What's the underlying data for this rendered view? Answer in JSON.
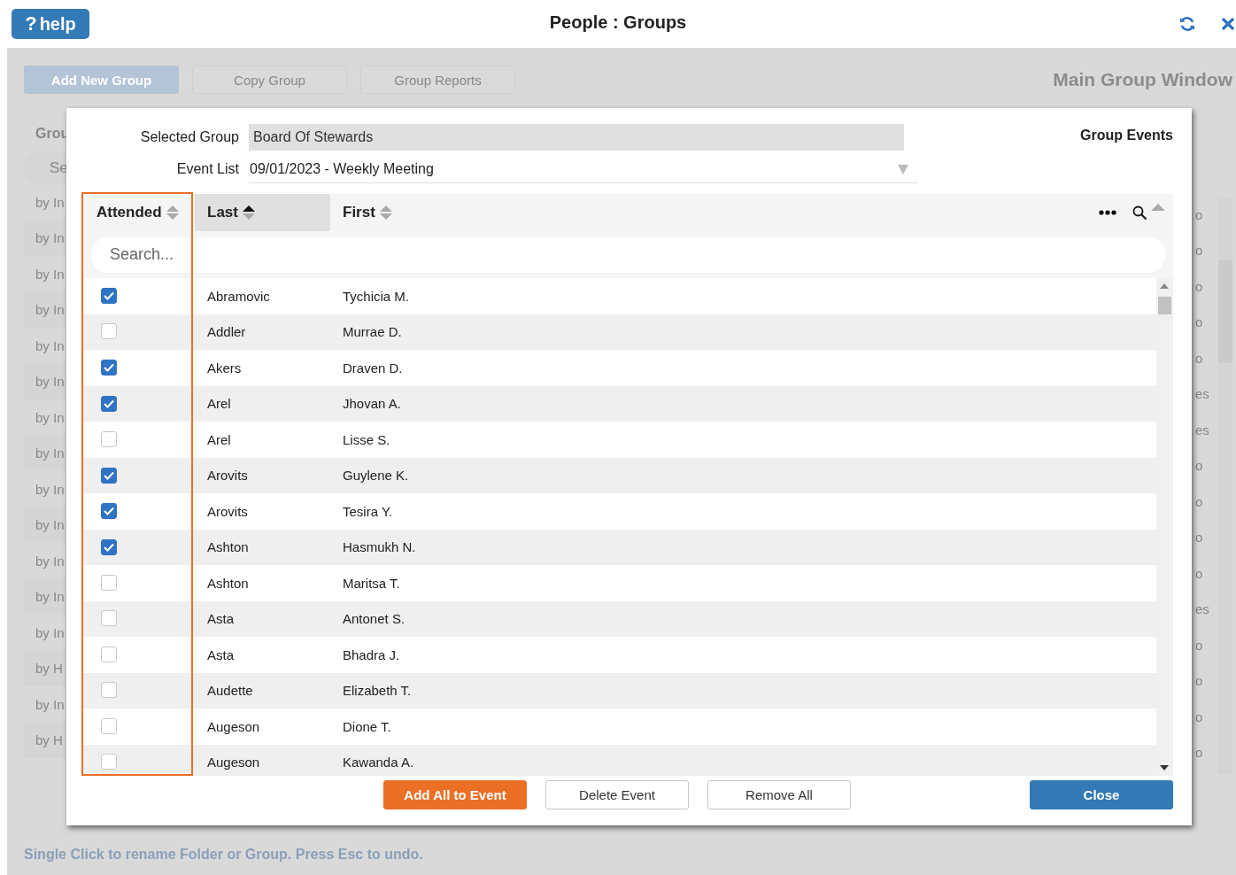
{
  "header": {
    "help_button": {
      "icon": "?",
      "label": "help"
    },
    "title": "People : Groups"
  },
  "background": {
    "toolbar": [
      {
        "label": "Add New Group",
        "kind": "primary"
      },
      {
        "label": "Copy Group",
        "kind": "plain"
      },
      {
        "label": "Group Reports",
        "kind": "plain"
      }
    ],
    "window_title": "Main Group Window",
    "panel_label": "Grou",
    "search_placeholder": "Se",
    "left_rows": [
      "by In",
      "by In",
      "by In",
      "by In",
      "by In",
      "by In",
      "by In",
      "by In",
      "by In",
      "by In",
      "by In",
      "by In",
      "by In",
      "by H",
      "by In",
      "by H"
    ],
    "right_rows": [
      "o",
      "o",
      "o",
      "o",
      "o",
      "es",
      "es",
      "o",
      "o",
      "o",
      "o",
      "es",
      "o",
      "o",
      "o",
      "o"
    ],
    "status_bar": "Single Click to rename Folder or Group. Press Esc to undo."
  },
  "dialog": {
    "title": "Group Events",
    "selected_group": {
      "label": "Selected Group",
      "value": "Board Of Stewards"
    },
    "event_list": {
      "label": "Event List",
      "value": "09/01/2023 - Weekly Meeting"
    },
    "table": {
      "columns": [
        {
          "label": "Attended",
          "sorted": false,
          "selected": false
        },
        {
          "label": "Last",
          "sorted": true,
          "selected": true
        },
        {
          "label": "First",
          "sorted": false,
          "selected": false
        }
      ],
      "search_placeholder": "Search...",
      "rows": [
        {
          "attended": true,
          "last": "Abramovic",
          "first": "Tychicia M."
        },
        {
          "attended": false,
          "last": "Addler",
          "first": "Murrae D."
        },
        {
          "attended": true,
          "last": "Akers",
          "first": "Draven D."
        },
        {
          "attended": true,
          "last": "Arel",
          "first": "Jhovan A."
        },
        {
          "attended": false,
          "last": "Arel",
          "first": "Lisse S."
        },
        {
          "attended": true,
          "last": "Arovits",
          "first": "Guylene K."
        },
        {
          "attended": true,
          "last": "Arovits",
          "first": "Tesira Y."
        },
        {
          "attended": true,
          "last": "Ashton",
          "first": "Hasmukh N."
        },
        {
          "attended": false,
          "last": "Ashton",
          "first": "Maritsa T."
        },
        {
          "attended": false,
          "last": "Asta",
          "first": "Antonet S."
        },
        {
          "attended": false,
          "last": "Asta",
          "first": "Bhadra J."
        },
        {
          "attended": false,
          "last": "Audette",
          "first": "Elizabeth T."
        },
        {
          "attended": false,
          "last": "Augeson",
          "first": "Dione T."
        },
        {
          "attended": false,
          "last": "Augeson",
          "first": "Kawanda A."
        }
      ]
    },
    "buttons": [
      {
        "label": "Add All to Event",
        "kind": "accent"
      },
      {
        "label": "Delete Event",
        "kind": "outline"
      },
      {
        "label": "Remove All",
        "kind": "outline"
      },
      {
        "label": "Close",
        "kind": "primary"
      }
    ]
  }
}
